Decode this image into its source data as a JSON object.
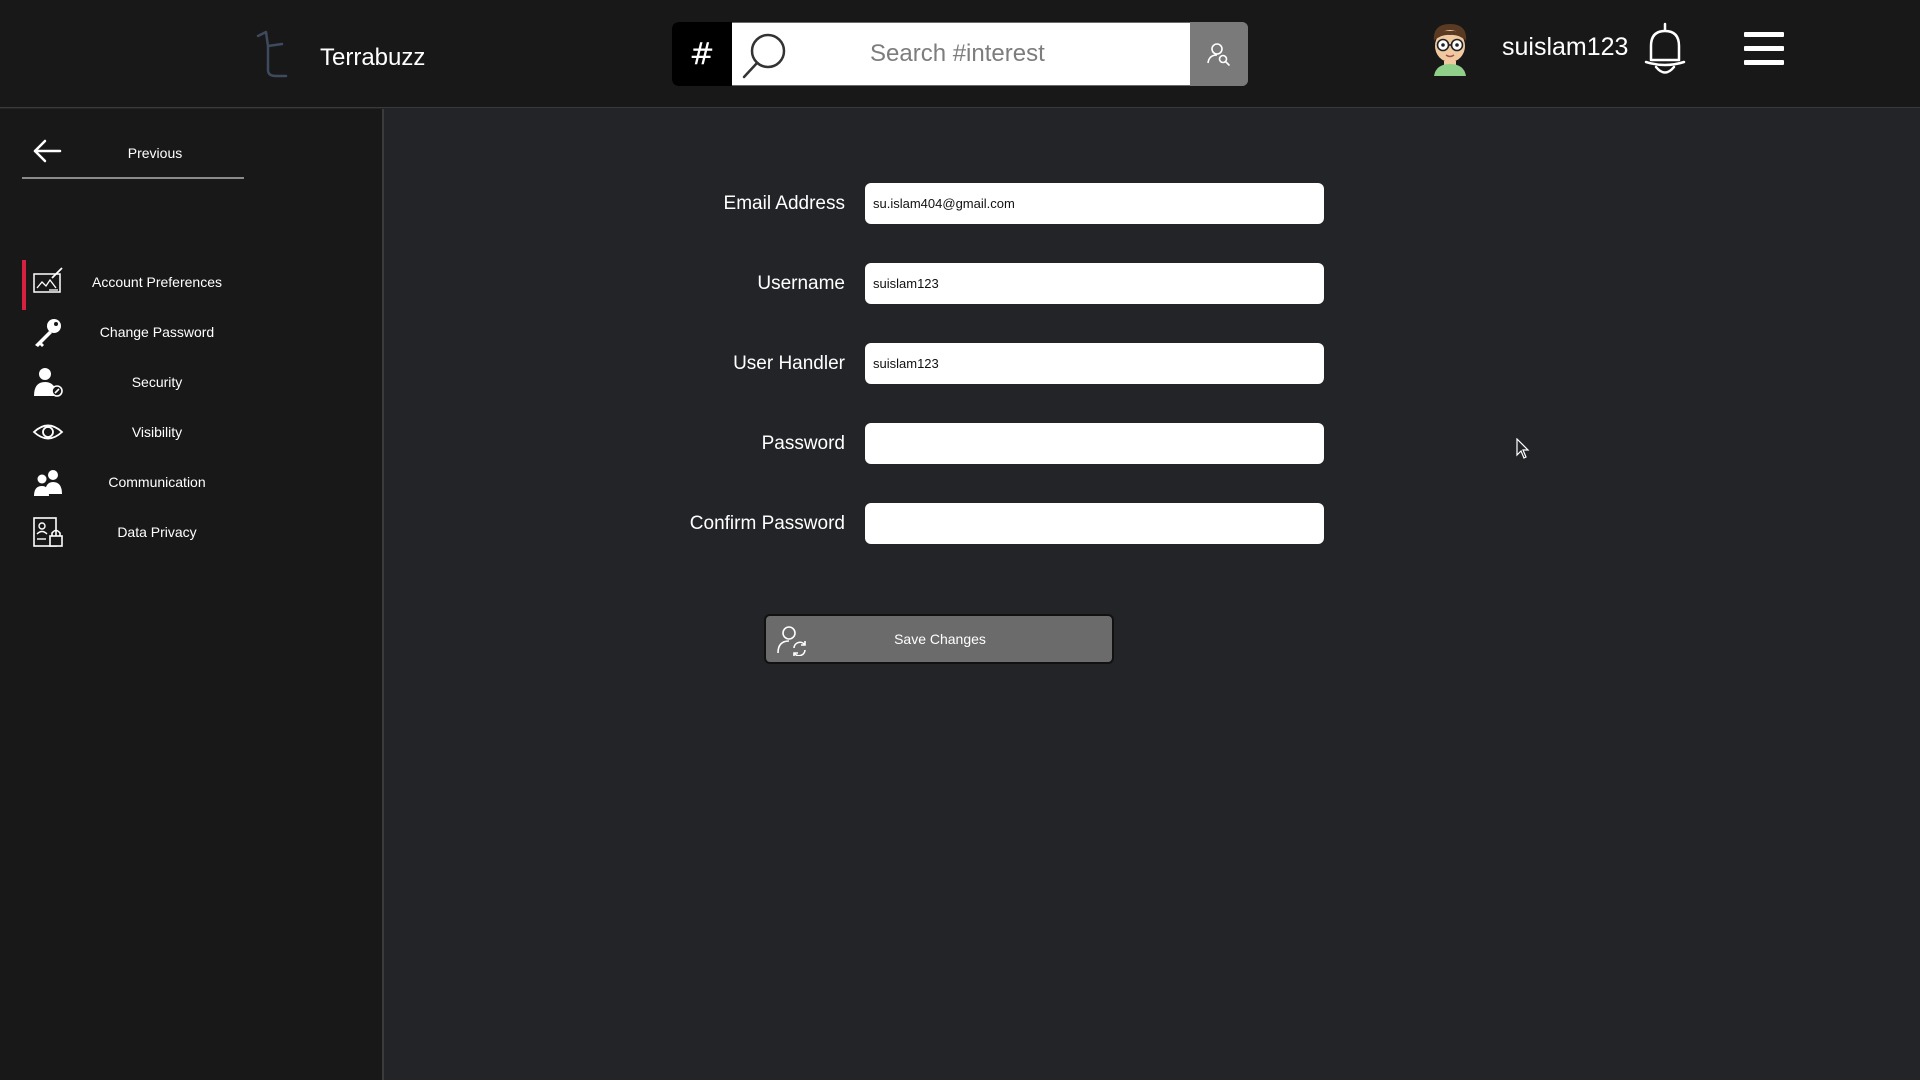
{
  "header": {
    "brand_name": "Terrabuzz",
    "search_prefix": "#",
    "search_placeholder": "Search #interest",
    "username": "suislam123"
  },
  "sidebar": {
    "previous_label": "Previous",
    "items": [
      {
        "label": "Account Preferences",
        "icon": "account-preferences-icon",
        "active": true
      },
      {
        "label": "Change Password",
        "icon": "key-icon",
        "active": false
      },
      {
        "label": "Security",
        "icon": "security-user-icon",
        "active": false
      },
      {
        "label": "Visibility",
        "icon": "eye-icon",
        "active": false
      },
      {
        "label": "Communication",
        "icon": "users-icon",
        "active": false
      },
      {
        "label": "Data Privacy",
        "icon": "data-privacy-icon",
        "active": false
      }
    ]
  },
  "form": {
    "email_label": "Email Address",
    "email_value": "su.islam404@gmail.com",
    "username_label": "Username",
    "username_value": "suislam123",
    "handler_label": "User Handler",
    "handler_value": "suislam123",
    "password_label": "Password",
    "password_value": "",
    "confirm_label": "Confirm Password",
    "confirm_value": "",
    "save_label": "Save Changes"
  },
  "colors": {
    "background": "#232427",
    "topbar": "#181818",
    "sidebar": "#181818",
    "active_indicator": "#d5203f",
    "button": "#6b6b6b"
  }
}
